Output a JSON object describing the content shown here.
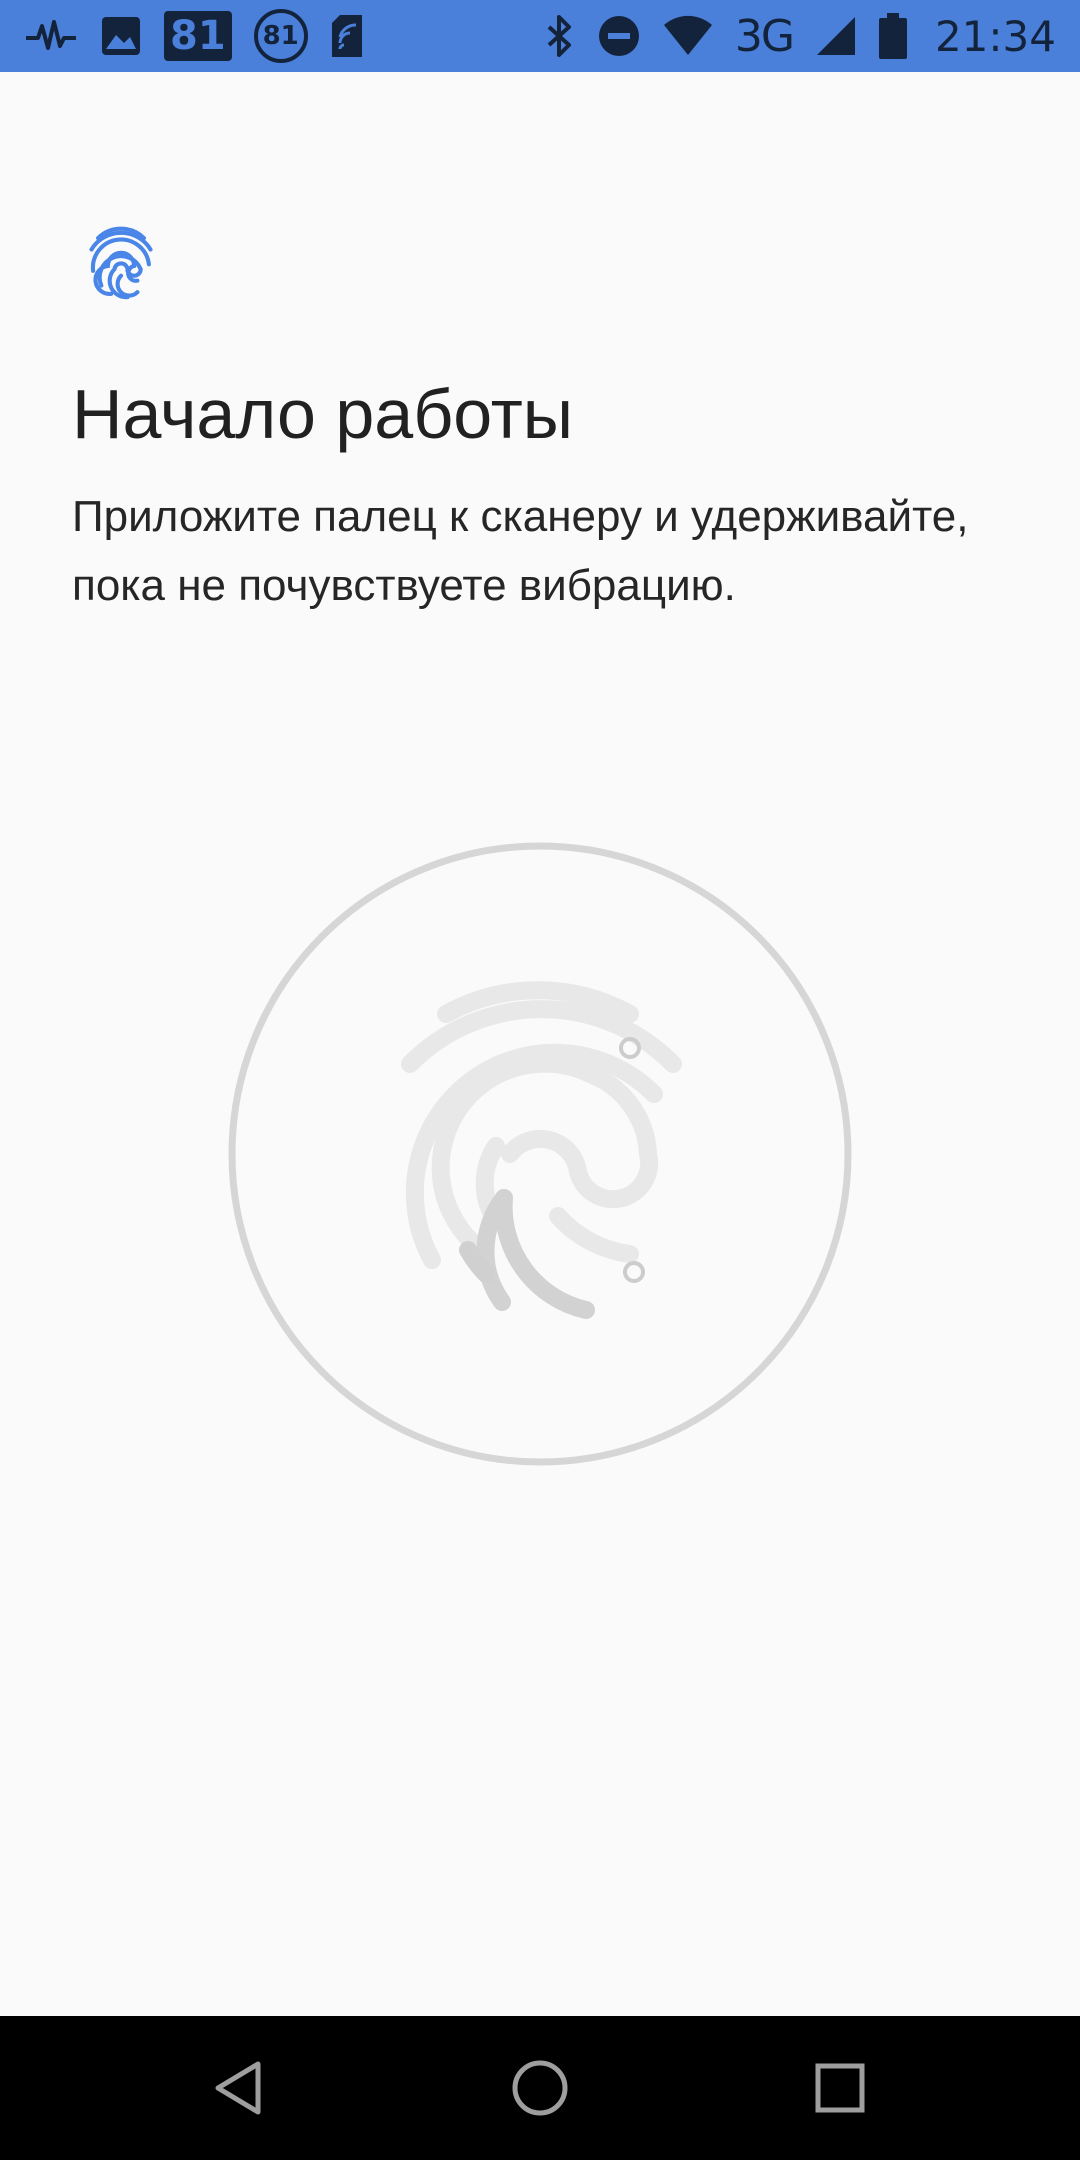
{
  "status_bar": {
    "notification_badge_square": "81",
    "notification_badge_circle": "81",
    "network_type": "3G",
    "time": "21:34",
    "icons": [
      "activity-icon",
      "image-icon",
      "sim-card-icon",
      "bluetooth-icon",
      "do-not-disturb-icon",
      "wifi-icon",
      "signal-icon",
      "battery-icon"
    ]
  },
  "page": {
    "title": "Начало работы",
    "description": "Приложите палец к сканеру и удерживайте, пока не почувствуете вибрацию.",
    "header_icon": "fingerprint-icon",
    "sensor_icon": "fingerprint-icon"
  },
  "navigation": {
    "icons": [
      "back-icon",
      "home-icon",
      "recents-icon"
    ]
  },
  "colors": {
    "status_bar": "#4a80d9",
    "accent": "#4a86e8",
    "background": "#fafafa",
    "ring": "#d6d6d6",
    "fingerprint_light": "#e6e6e6",
    "fingerprint_dark": "#cccccc",
    "nav_bar": "#000000"
  }
}
